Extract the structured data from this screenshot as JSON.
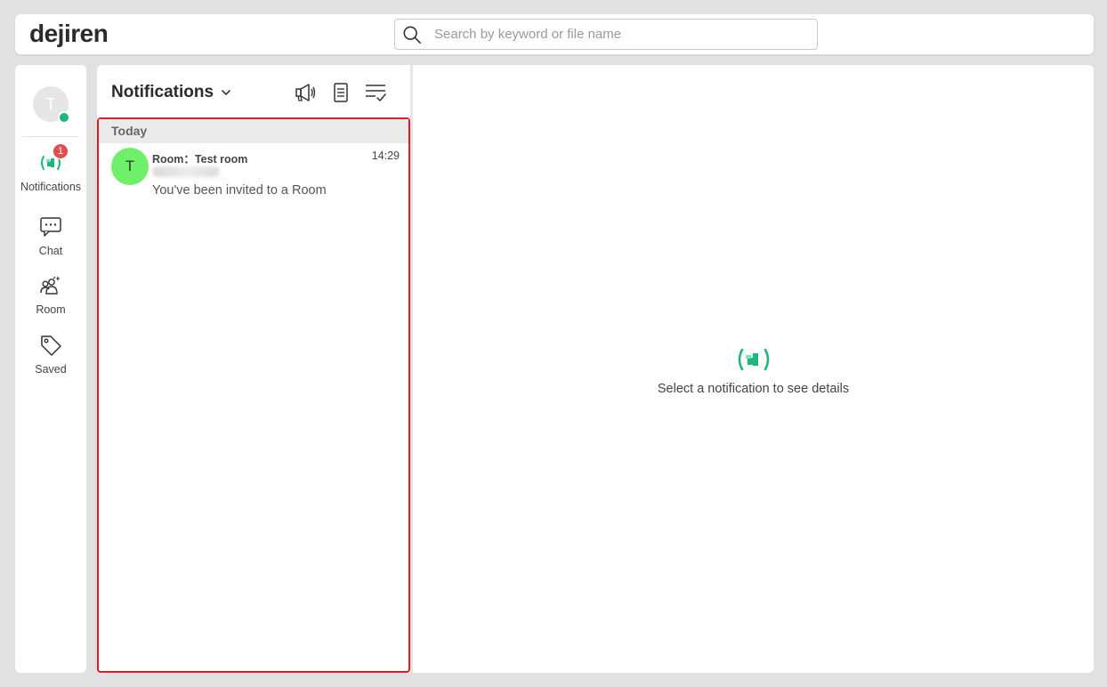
{
  "app": {
    "logo": "dejiren"
  },
  "search": {
    "placeholder": "Search by keyword or file name"
  },
  "user": {
    "initial": "T",
    "status_color": "#1bb87a"
  },
  "nav": {
    "items": [
      {
        "label": "Notifications",
        "icon": "notification-broadcast-icon",
        "badge": "1",
        "active": true
      },
      {
        "label": "Chat",
        "icon": "chat-icon"
      },
      {
        "label": "Room",
        "icon": "room-group-icon"
      },
      {
        "label": "Saved",
        "icon": "tag-icon"
      }
    ]
  },
  "panel": {
    "title": "Notifications",
    "section": "Today",
    "notifications": [
      {
        "avatar_initial": "T",
        "avatar_color": "#6ef06a",
        "room": "Room：Test room",
        "time": "14:29",
        "message": "You've been invited to a Room"
      }
    ]
  },
  "detail": {
    "empty_text": "Select a notification to see details"
  },
  "colors": {
    "accent": "#1bb87a",
    "badge": "#e04e4e",
    "highlight_border": "#e31b23"
  }
}
